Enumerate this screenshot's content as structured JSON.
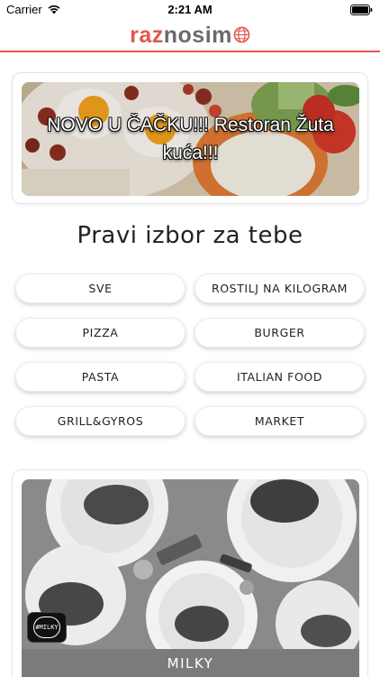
{
  "status_bar": {
    "carrier": "Carrier",
    "time": "2:21 AM",
    "icons": [
      "wifi-icon",
      "battery-icon"
    ]
  },
  "header": {
    "logo_part_a": "raz",
    "logo_part_b": "nosim",
    "logo_icon": "globe-icon",
    "accent_color": "#e2574c"
  },
  "promo": {
    "text": "NOVO U ČAČKU!!! Restoran Žuta kuća!!!"
  },
  "section_title": "Pravi izbor za tebe",
  "categories": [
    "SVE",
    "ROSTILJ NA KILOGRAM",
    "PIZZA",
    "BURGER",
    "PASTA",
    "ITALIAN FOOD",
    "GRILL&GYROS",
    "MARKET"
  ],
  "restaurant": {
    "name": "MILKY",
    "logo_text": "#MILKY"
  }
}
